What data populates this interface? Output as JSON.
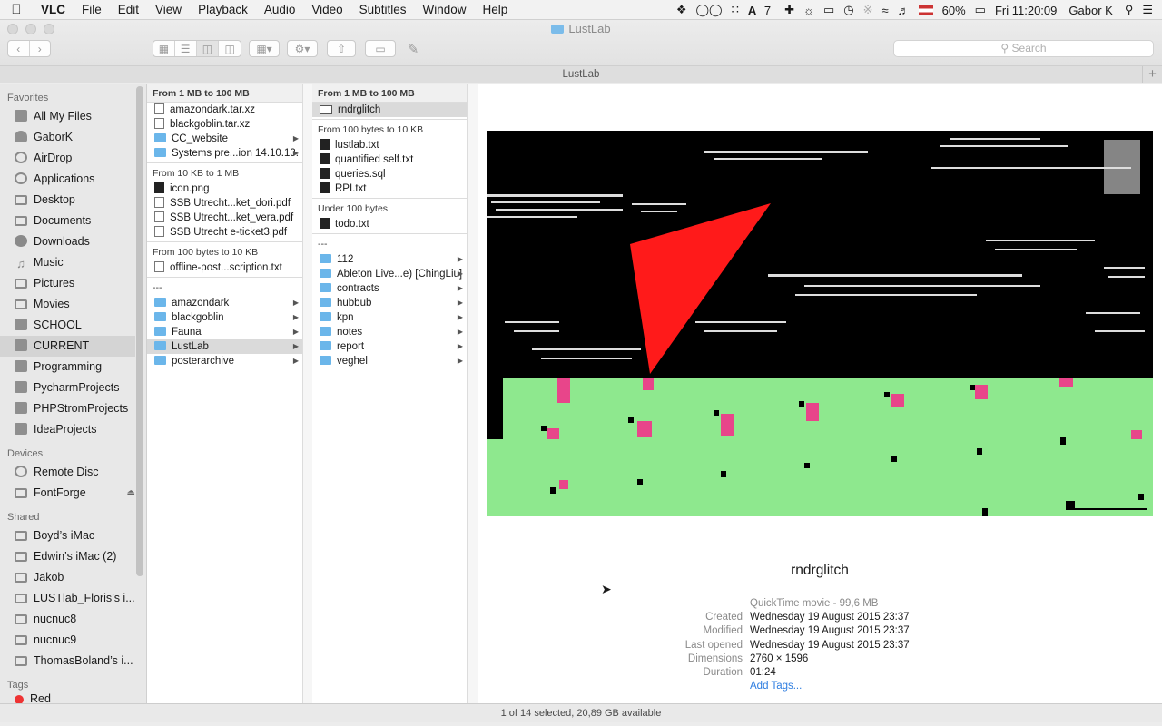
{
  "menubar": {
    "apple": "",
    "app": "VLC",
    "menus": [
      "File",
      "Edit",
      "View",
      "Playback",
      "Audio",
      "Video",
      "Subtitles",
      "Window",
      "Help"
    ],
    "status": {
      "ai_count": "7",
      "battery": "60%",
      "clock": "Fri 11:20:09",
      "user": "Gabor K"
    }
  },
  "window": {
    "title": "LustLab",
    "tab_title": "LustLab",
    "search_placeholder": "Search",
    "tab_add": "+"
  },
  "sidebar": {
    "favorites_label": "Favorites",
    "favorites": [
      "All My Files",
      "GaborK",
      "AirDrop",
      "Applications",
      "Desktop",
      "Documents",
      "Downloads",
      "Music",
      "Pictures",
      "Movies",
      "SCHOOL",
      "CURRENT",
      "Programming",
      "PycharmProjects",
      "PHPStromProjects",
      "IdeaProjects"
    ],
    "devices_label": "Devices",
    "devices": [
      "Remote Disc",
      "FontForge"
    ],
    "shared_label": "Shared",
    "shared": [
      "Boyd’s iMac",
      "Edwin’s iMac (2)",
      "Jakob",
      "LUSTlab_Floris’s i...",
      "nucnuc8",
      "nucnuc9",
      "ThomasBoland’s i..."
    ],
    "tags_label": "Tags",
    "tags_partial": "Red"
  },
  "column1": {
    "header": "From 1 MB to 100 MB",
    "group1": [
      "amazondark.tar.xz",
      "blackgoblin.tar.xz",
      "CC_website",
      "Systems pre...ion 14.10.13."
    ],
    "group2_label": "From 10 KB to 1 MB",
    "group2": [
      "icon.png",
      "SSB Utrecht...ket_dori.pdf",
      "SSB Utrecht...ket_vera.pdf",
      "SSB Utrecht e-ticket3.pdf"
    ],
    "group3_label": "From 100 bytes to 10 KB",
    "group3": [
      "offline-post...scription.txt"
    ],
    "group4_label": "---",
    "group4": [
      "amazondark",
      "blackgoblin",
      "Fauna",
      "LustLab",
      "posterarchive"
    ]
  },
  "column2": {
    "header": "From 1 MB to 100 MB",
    "group1": [
      "rndrglitch"
    ],
    "group2_label": "From 100 bytes to 10 KB",
    "group2": [
      "lustlab.txt",
      "quantified self.txt",
      "queries.sql",
      "RPI.txt"
    ],
    "group3_label": "Under 100 bytes",
    "group3": [
      "todo.txt"
    ],
    "group4_label": "---",
    "group4": [
      "112",
      "Ableton Live...e) [ChingLiu]",
      "contracts",
      "hubbub",
      "kpn",
      "notes",
      "report",
      "veghel"
    ]
  },
  "preview": {
    "name": "rndrglitch",
    "kind": "QuickTime movie - 99,6 MB",
    "created_label": "Created",
    "created": "Wednesday 19 August 2015 23:37",
    "modified_label": "Modified",
    "modified": "Wednesday 19 August 2015 23:37",
    "opened_label": "Last opened",
    "opened": "Wednesday 19 August 2015 23:37",
    "dimensions_label": "Dimensions",
    "dimensions": "2760 × 1596",
    "duration_label": "Duration",
    "duration": "01:24",
    "add_tags": "Add Tags..."
  },
  "statusbar": "1 of 14 selected, 20,89 GB available",
  "colors": {
    "folder": "#6bb6ea",
    "link": "#2e7de0",
    "thumb_green": "#8ee88e",
    "thumb_red": "#ff1a1a"
  }
}
